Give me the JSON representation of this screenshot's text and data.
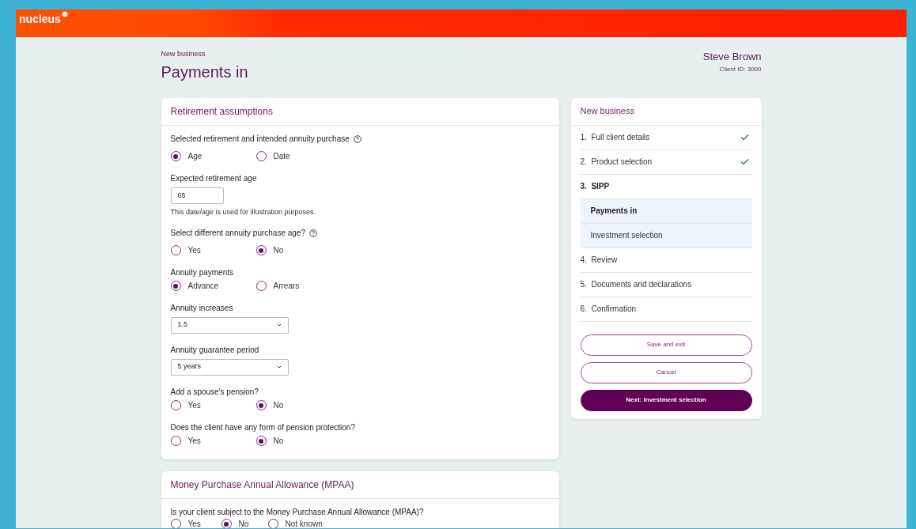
{
  "header": {
    "logo": "nucleus"
  },
  "page": {
    "breadcrumb": "New business",
    "title": "Payments in"
  },
  "client": {
    "name": "Steve Brown",
    "id": "Client ID: 3000"
  },
  "sections": [
    {
      "title": "Retirement assumptions",
      "questions": [
        {
          "kind": "radio",
          "label": "Selected retirement and intended annuity purchase",
          "help": true,
          "options": [
            {
              "label": "Age",
              "selected": true
            },
            {
              "label": "Date",
              "selected": false
            }
          ]
        },
        {
          "kind": "input",
          "label": "Expected retirement age",
          "value": "65",
          "note": "This date/age is used for illustration purposes."
        },
        {
          "kind": "radio",
          "label": "Select different annuity purchase age?",
          "help": true,
          "options": [
            {
              "label": "Yes",
              "selected": false
            },
            {
              "label": "No",
              "selected": true
            }
          ]
        },
        {
          "kind": "radio",
          "label": "Annuity payments",
          "help": false,
          "options": [
            {
              "label": "Advance",
              "selected": true
            },
            {
              "label": "Arrears",
              "selected": false
            }
          ]
        },
        {
          "kind": "select",
          "label": "Annuity increases",
          "value": "1.5"
        },
        {
          "kind": "select",
          "label": "Annuity guarantee period",
          "value": "5 years"
        },
        {
          "kind": "radio",
          "label": "Add a spouse's pension?",
          "help": false,
          "options": [
            {
              "label": "Yes",
              "selected": false
            },
            {
              "label": "No",
              "selected": true
            }
          ]
        },
        {
          "kind": "radio",
          "label": "Does the client have any form of pension protection?",
          "help": false,
          "options": [
            {
              "label": "Yes",
              "selected": false
            },
            {
              "label": "No",
              "selected": true
            }
          ]
        }
      ]
    },
    {
      "title": "Money Purchase Annual Allowance (MPAA)",
      "questions": [
        {
          "kind": "radio",
          "label": "Is your client subject to the Money Purchase Annual Allowance (MPAA)?",
          "help": false,
          "options": [
            {
              "label": "Yes",
              "selected": false
            },
            {
              "label": "No",
              "selected": true
            },
            {
              "label": "Not known",
              "selected": false
            }
          ]
        }
      ]
    }
  ],
  "progress": {
    "title": "New business",
    "steps": [
      {
        "number": "1.",
        "label": "Full client details",
        "completed": true,
        "current": false
      },
      {
        "number": "2.",
        "label": "Product selection",
        "completed": true,
        "current": false
      },
      {
        "number": "3.",
        "label": "SIPP",
        "completed": false,
        "current": true,
        "children": [
          {
            "label": "Payments in",
            "selected": true
          },
          {
            "label": "Investment selection",
            "selected": false
          }
        ]
      },
      {
        "number": "4.",
        "label": "Review",
        "completed": false,
        "current": false
      },
      {
        "number": "5.",
        "label": "Documents and declarations",
        "completed": false,
        "current": false
      },
      {
        "number": "6.",
        "label": "Confirmation",
        "completed": false,
        "current": false
      }
    ],
    "buttons": [
      {
        "label": "Save and exit",
        "kind": "outline"
      },
      {
        "label": "Cancel",
        "kind": "outline"
      },
      {
        "label": "Next: Investment selection",
        "kind": "primary"
      }
    ]
  }
}
